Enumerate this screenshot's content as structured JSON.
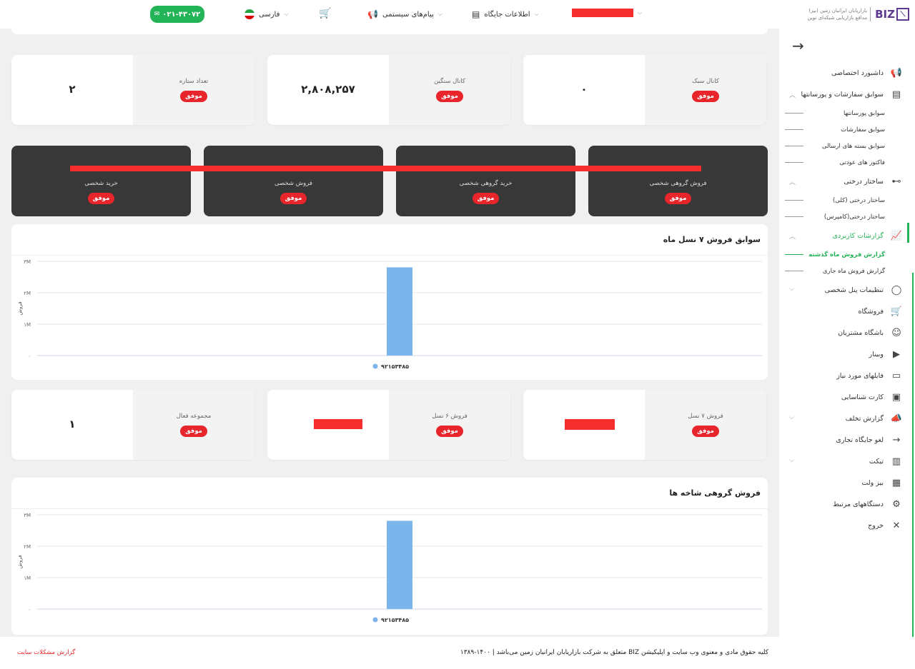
{
  "header": {
    "phone": "۰۲۱-۴۳۰۷۲",
    "language": "فارسی",
    "system_messages": "پیام‌های سیستمی",
    "site_info": "اطلاعات جایگاه"
  },
  "brand": {
    "logo_text": "BIZ",
    "tagline_1": "بازاریابان ایرانیان زمین (بیز)",
    "tagline_2": "مدافع بازاریابی شبکه‌ای نوین"
  },
  "sidebar": {
    "items": [
      {
        "label": "داشبورد اختصاصی",
        "icon": "megaphone-icon"
      },
      {
        "label": "سوابق سفارشات و پورسانتها",
        "icon": "document-icon",
        "subs": [
          "سوابق پورسانتها",
          "سوابق سفارشات",
          "سوابق بسته های ارسالی",
          "فاکتور های عودتی"
        ]
      },
      {
        "label": "ساختار درختی",
        "icon": "tree-icon",
        "subs": [
          "ساختار درختی (کلی)",
          "ساختار درختی(کامپرس)"
        ]
      },
      {
        "label": "گزارشات کاربردی",
        "icon": "chart-icon",
        "subs": [
          "گزارش فروش ماه گذشته",
          "گزارش فروش ماه جاری"
        ]
      },
      {
        "label": "تنظیمات پنل شخصی",
        "icon": "user-icon"
      },
      {
        "label": "فروشگاه",
        "icon": "cart-icon"
      },
      {
        "label": "باشگاه مشتریان",
        "icon": "club-icon"
      },
      {
        "label": "وبینار",
        "icon": "video-icon"
      },
      {
        "label": "فایلهای مورد نیاز",
        "icon": "folder-icon"
      },
      {
        "label": "کارت شناسایی",
        "icon": "id-card-icon"
      },
      {
        "label": "گزارش تخلف",
        "icon": "alert-megaphone-icon"
      },
      {
        "label": "لغو جایگاه تجاری",
        "icon": "arrow-out-icon"
      },
      {
        "label": "تیکت",
        "icon": "barcode-icon"
      },
      {
        "label": "بیز ولت",
        "icon": "wallet-icon"
      },
      {
        "label": "دستگاههای مرتبط",
        "icon": "device-icon"
      },
      {
        "label": "خروج",
        "icon": "close-icon"
      }
    ]
  },
  "badge_label": "موفق",
  "stats_row1": [
    {
      "label": "کانال سبک",
      "value": "۰"
    },
    {
      "label": "کانال سنگین",
      "value": "۲,۸۰۸,۲۵۷"
    },
    {
      "label": "تعداد ستاره",
      "value": "۲"
    }
  ],
  "dark_cards": [
    {
      "label": "فروش گروهی شخصی"
    },
    {
      "label": "خرید گروهی شخصی"
    },
    {
      "label": "فروش شخصی"
    },
    {
      "label": "خرید شخصی"
    }
  ],
  "stats_row2": [
    {
      "label": "فروش ۷ نسل",
      "value": ""
    },
    {
      "label": "فروش ۶ نسل",
      "value": ""
    },
    {
      "label": "مجموعه فعال",
      "value": "۱"
    }
  ],
  "chart1": {
    "title": "سوابق فروش ۷ نسل ماه",
    "ylabel": "فروش",
    "ticks": [
      "۳M",
      "۲M",
      "۱M",
      "۰"
    ],
    "legend": "۹۲۱۵۳۴۸۵"
  },
  "chart2": {
    "title": "فروش گروهی شاخه ها",
    "ylabel": "فروش",
    "ticks": [
      "۳M",
      "۲M",
      "۱M",
      "۰"
    ],
    "legend": "۹۲۱۵۳۴۸۵"
  },
  "chart_data": [
    {
      "type": "bar",
      "title": "سوابق فروش ۷ نسل ماه",
      "ylabel": "فروش",
      "ylim": [
        0,
        3000000
      ],
      "series": [
        {
          "name": "۹۲۱۵۳۴۸۵",
          "values": [
            2808257
          ],
          "color": "#7cb5ec"
        }
      ],
      "grid": true,
      "legend": "bottom"
    },
    {
      "type": "bar",
      "title": "فروش گروهی شاخه ها",
      "ylabel": "فروش",
      "ylim": [
        0,
        3000000
      ],
      "series": [
        {
          "name": "۹۲۱۵۳۴۸۵",
          "values": [
            2808257
          ],
          "color": "#7cb5ec"
        }
      ],
      "grid": true,
      "legend": "bottom"
    }
  ],
  "footer": {
    "copyright": "کلیه حقوق مادی و معنوی وب سایت و اپلیکیشن BIZ متعلق به شرکت بازاریابان ایرانیان زمین می‌باشد | ۱۴۰۰-۱۳۸۹",
    "report_link": "گزارش مشکلات سایت"
  },
  "colors": {
    "accent": "#22b457",
    "badge": "#e8252b",
    "dark_card": "#383838",
    "bar": "#7cb5ec"
  }
}
